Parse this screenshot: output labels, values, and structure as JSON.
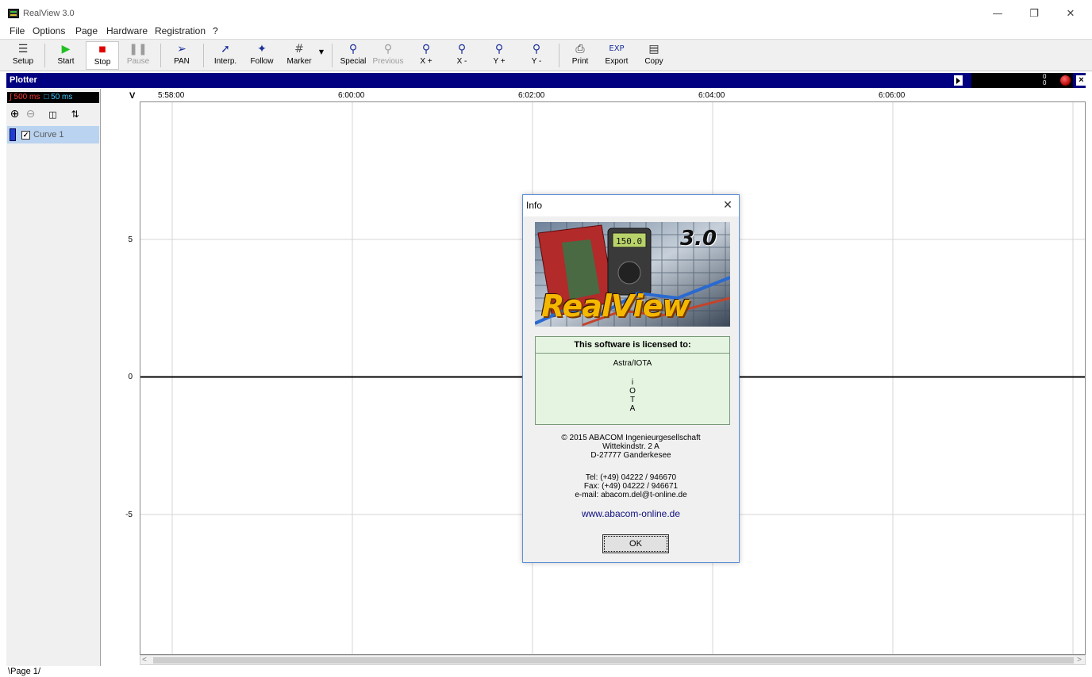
{
  "window": {
    "title": "RealView 3.0"
  },
  "menu": [
    "File",
    "Options",
    "Page",
    "Hardware",
    "Registration",
    "?"
  ],
  "toolbar": {
    "setup": "Setup",
    "start": "Start",
    "stop": "Stop",
    "pause": "Pause",
    "pan": "PAN",
    "interp": "Interp.",
    "follow": "Follow",
    "marker": "Marker",
    "special": "Special",
    "previous": "Previous",
    "x_plus": "X +",
    "x_minus": "X -",
    "y_plus": "Y +",
    "y_minus": "Y -",
    "print": "Print",
    "export_icon": "EXP",
    "export": "Export",
    "copy": "Copy"
  },
  "plotter": {
    "title": "Plotter",
    "counter_top": "0",
    "counter_bottom": "0"
  },
  "panel": {
    "rate_sample": "500 ms",
    "rate_display": "50 ms"
  },
  "curves": [
    {
      "label": "Curve 1",
      "checked": true,
      "color": "#1f3fd0"
    }
  ],
  "axis": {
    "y_unit": "V",
    "y_ticks": [
      "5",
      "0",
      "-5"
    ],
    "x_ticks": [
      "5:58:00",
      "6:00:00",
      "6:02:00",
      "6:04:00",
      "6:06:00"
    ]
  },
  "page_tab": "Page 1",
  "dialog": {
    "title": "Info",
    "version": "3.0",
    "brand": "RealView",
    "meter_reading": "150.0",
    "license_heading": "This software is licensed to:",
    "licensee": "Astra/IOTA",
    "licensee_lines": [
      "i",
      "O",
      "T",
      "A"
    ],
    "copyright": "© 2015 ABACOM Ingenieurgesellschaft",
    "street": "Wittekindstr. 2 A",
    "city": "D-27777 Ganderkesee",
    "tel": "Tel: (+49) 04222 / 946670",
    "fax": "Fax: (+49) 04222 / 946671",
    "email": "e-mail: abacom.del@t-online.de",
    "website": "www.abacom-online.de",
    "ok": "OK"
  },
  "colors": {
    "plotter_bar": "#000080",
    "curve_row": "#b9d3f0",
    "license_bg": "#e4f4e0",
    "brand": "#f5b800"
  }
}
